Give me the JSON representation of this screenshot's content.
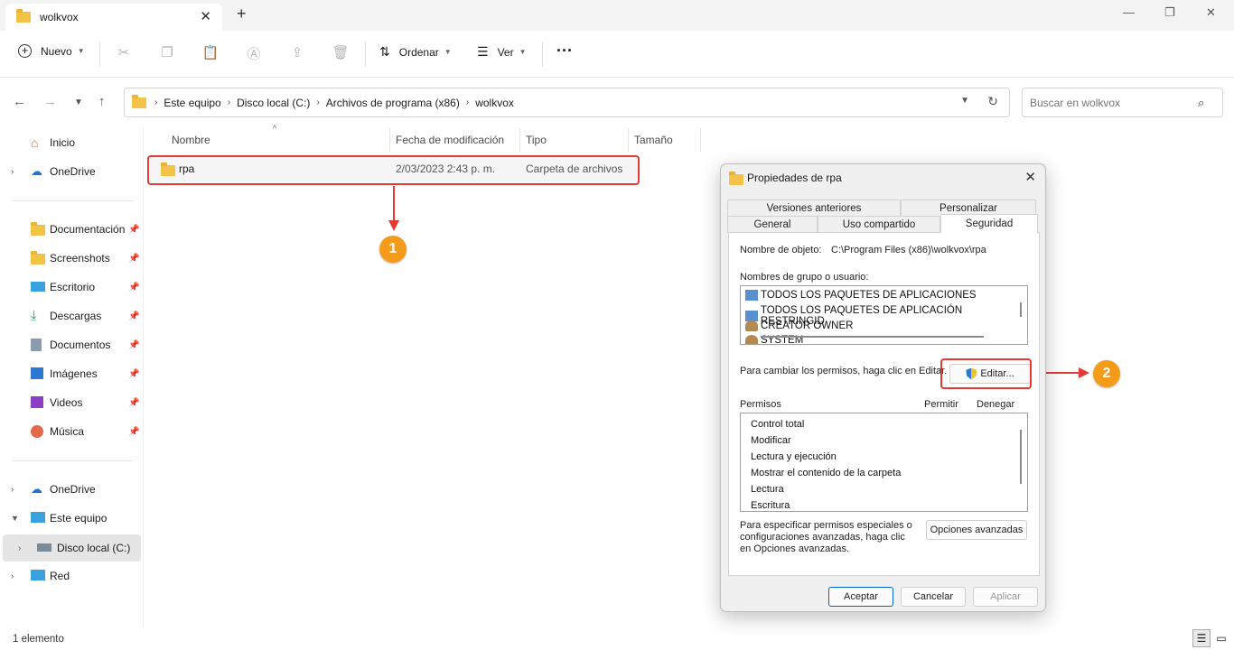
{
  "window": {
    "tab_title": "wolkvox",
    "close": "✕",
    "new_tab": "+",
    "minimize": "—",
    "maximize": "❐",
    "close_window": "✕"
  },
  "toolbar": {
    "new_label": "Nuevo",
    "sort_label": "Ordenar",
    "view_label": "Ver",
    "more": "···"
  },
  "address": {
    "crumbs": [
      "Este equipo",
      "Disco local (C:)",
      "Archivos de programa (x86)",
      "wolkvox"
    ],
    "search_placeholder": "Buscar en wolkvox"
  },
  "sidebar": {
    "items": [
      {
        "label": "Inicio"
      },
      {
        "label": "OneDrive"
      },
      {
        "label": "Documentación"
      },
      {
        "label": "Screenshots"
      },
      {
        "label": "Escritorio"
      },
      {
        "label": "Descargas"
      },
      {
        "label": "Documentos"
      },
      {
        "label": "Imágenes"
      },
      {
        "label": "Videos"
      },
      {
        "label": "Música"
      },
      {
        "label": "OneDrive"
      },
      {
        "label": "Este equipo"
      },
      {
        "label": "Disco local (C:)"
      },
      {
        "label": "Red"
      }
    ]
  },
  "files": {
    "columns": [
      "Nombre",
      "Fecha de modificación",
      "Tipo",
      "Tamaño"
    ],
    "rows": [
      {
        "name": "rpa",
        "modified": "2/03/2023 2:43 p. m.",
        "type": "Carpeta de archivos",
        "size": ""
      }
    ]
  },
  "status": {
    "count": "1 elemento"
  },
  "annotations": {
    "badge1": "1",
    "badge2": "2"
  },
  "dialog": {
    "title": "Propiedades de rpa",
    "tabs_row1": [
      "Versiones anteriores",
      "Personalizar"
    ],
    "tabs_row2": [
      "General",
      "Uso compartido",
      "Seguridad"
    ],
    "object_name_label": "Nombre de objeto:",
    "object_name_value": "C:\\Program Files (x86)\\wolkvox\\rpa",
    "groups_label": "Nombres de grupo o usuario:",
    "groups": [
      "TODOS LOS PAQUETES DE APLICACIONES",
      "TODOS LOS PAQUETES DE APLICACIÓN RESTRINGID",
      "CREATOR OWNER",
      "SYSTEM"
    ],
    "change_text": "Para cambiar los permisos, haga clic en Editar.",
    "edit_button": "Editar...",
    "perm_header": "Permisos",
    "allow_header": "Permitir",
    "deny_header": "Denegar",
    "permissions": [
      "Control total",
      "Modificar",
      "Lectura y ejecución",
      "Mostrar el contenido de la carpeta",
      "Lectura",
      "Escritura"
    ],
    "special_text": [
      "Para especificar permisos especiales o",
      "configuraciones avanzadas, haga clic",
      "en Opciones avanzadas."
    ],
    "advanced_button": "Opciones avanzadas",
    "ok_button": "Aceptar",
    "cancel_button": "Cancelar",
    "apply_button": "Aplicar"
  }
}
